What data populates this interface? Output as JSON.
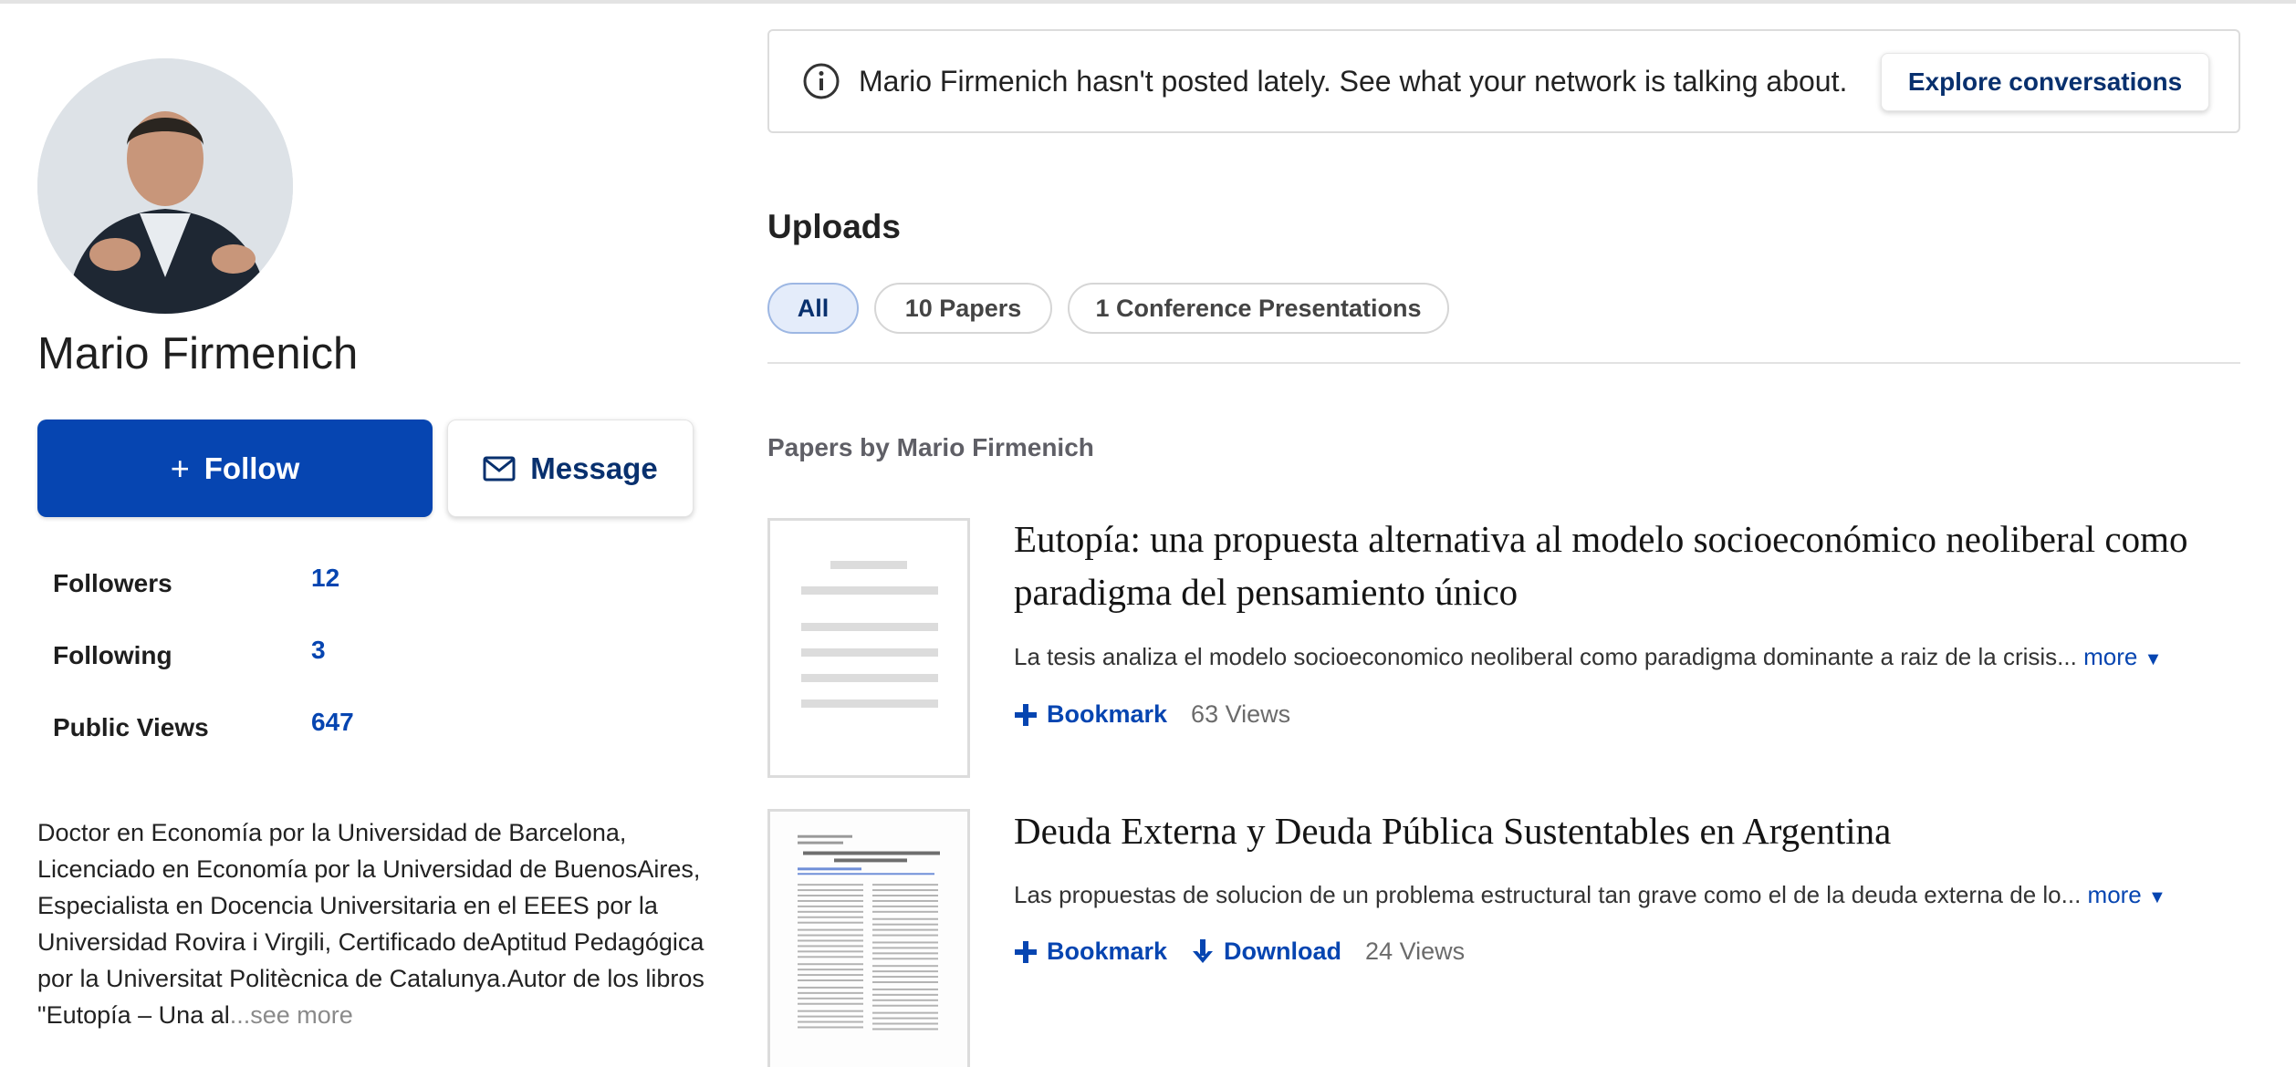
{
  "profile": {
    "name": "Mario Firmenich",
    "follow_label": "Follow",
    "message_label": "Message",
    "stats": [
      {
        "label": "Followers",
        "value": "12"
      },
      {
        "label": "Following",
        "value": "3"
      },
      {
        "label": "Public Views",
        "value": "647"
      }
    ],
    "bio_text": "Doctor en Economía por la Universidad de Barcelona, Licenciado en Economía por la Universidad de BuenosAires, Especialista en Docencia Universitaria en el EEES por la Universidad Rovira i Virgili, Certificado deAptitud Pedagógica por la Universitat Politècnica de Catalunya.Autor de los libros \"Eutopía – Una al",
    "bio_see_more": "...see more"
  },
  "notice": {
    "text": "Mario Firmenich hasn't posted lately. See what your network is talking about.",
    "button_label": "Explore conversations"
  },
  "uploads": {
    "title": "Uploads",
    "filters": [
      "All",
      "10 Papers",
      "1 Conference Presentations"
    ],
    "active_filter": "All",
    "section_title": "Papers by Mario Firmenich"
  },
  "papers": [
    {
      "title": "Eutopía: una propuesta alternativa al modelo socioeconómico neoliberal como paradigma del pensamiento único",
      "abstract": "La tesis analiza el modelo socioeconomico neoliberal como paradigma dominante a raiz de la crisis...",
      "more_label": "more",
      "bookmark_label": "Bookmark",
      "views": "63 Views"
    },
    {
      "title": "Deuda Externa y Deuda Pública Sustentables en Argentina",
      "abstract": "Las propuestas de solucion de un problema estructural tan grave como el de la deuda externa de lo...",
      "more_label": "more",
      "bookmark_label": "Bookmark",
      "download_label": "Download",
      "views": "24 Views"
    }
  ],
  "colors": {
    "primary": "#0645b1",
    "dark_navy": "#08306e",
    "active_pill_bg": "#e4ecfa"
  }
}
